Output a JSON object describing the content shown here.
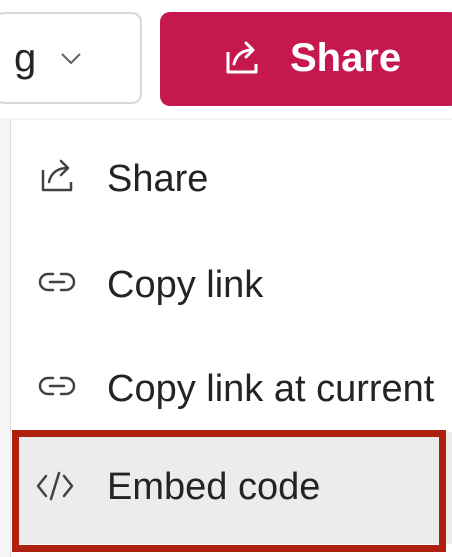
{
  "toolbar": {
    "dropdown_value": "g",
    "dropdown_icon": "chevron-down-icon",
    "share_button": {
      "label": "Share",
      "icon": "share-icon",
      "color": "#c4184f"
    }
  },
  "menu": {
    "items": [
      {
        "label": "Share",
        "icon": "share-icon"
      },
      {
        "label": "Copy link",
        "icon": "link-icon"
      },
      {
        "label": "Copy link at current",
        "icon": "link-icon"
      },
      {
        "label": "Embed code",
        "icon": "code-icon",
        "highlighted": true
      }
    ]
  },
  "colors": {
    "accent": "#c4184f",
    "highlight_border": "#b0200e",
    "hover_bg": "#ececec"
  }
}
